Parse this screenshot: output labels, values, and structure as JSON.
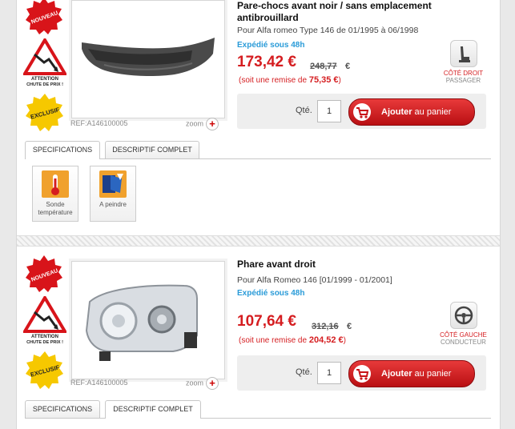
{
  "product1": {
    "badges": {
      "new": "NOUVEAU",
      "drop_line1": "ATTENTION",
      "drop_line2": "CHUTE DE PRIX !",
      "exclu": "EXCLUSIF"
    },
    "title": "Pare-chocs avant noir / sans emplacement antibrouillard",
    "compat": "Pour Alfa romeo Type 146 de 01/1995 à 06/1998",
    "shipping": "Expédié sous 48h",
    "price": "173,42 €",
    "old_price": "248,77",
    "old_currency": "€",
    "remise_prefix": "(soit une remise de ",
    "remise_value": "75,35 €",
    "remise_suffix": ")",
    "side_primary": "CÔTÉ DROIT",
    "side_secondary": "PASSAGER",
    "side_icon": "seat-icon",
    "qty_label": "Qté.",
    "qty_value": "1",
    "add_label": "Ajouter",
    "add_suffix": " au panier",
    "ref": "REF:A146100005",
    "zoom": "zoom",
    "tabs": [
      "SPECIFICATIONS",
      "DESCRIPTIF COMPLET"
    ],
    "features": [
      {
        "icon": "thermometer-icon",
        "line1": "Sonde",
        "line2": "température"
      },
      {
        "icon": "paint-icon",
        "line1": "A peindre",
        "line2": ""
      }
    ]
  },
  "product2": {
    "badges": {
      "new": "NOUVEAU",
      "drop_line1": "ATTENTION",
      "drop_line2": "CHUTE DE PRIX !",
      "exclu": "EXCLUSIF"
    },
    "title": "Phare avant droit",
    "compat": "Pour Alfa Romeo 146 [01/1999 - 01/2001]",
    "shipping": "Expédié sous 48h",
    "price": "107,64 €",
    "old_price": "312,16",
    "old_currency": "€",
    "remise_prefix": "(soit une remise de ",
    "remise_value": "204,52 €",
    "remise_suffix": ")",
    "side_primary": "CÔTÉ GAUCHE",
    "side_secondary": "CONDUCTEUR",
    "side_icon": "steering-wheel-icon",
    "qty_label": "Qté.",
    "qty_value": "1",
    "add_label": "Ajouter",
    "add_suffix": " au panier",
    "ref": "REF:A146100005",
    "zoom": "zoom",
    "tabs": [
      "SPECIFICATIONS",
      "DESCRIPTIF COMPLET"
    ]
  },
  "colors": {
    "accent": "#d51d20",
    "shipping": "#2a9bd8",
    "badge_orange": "#f0a12d"
  }
}
